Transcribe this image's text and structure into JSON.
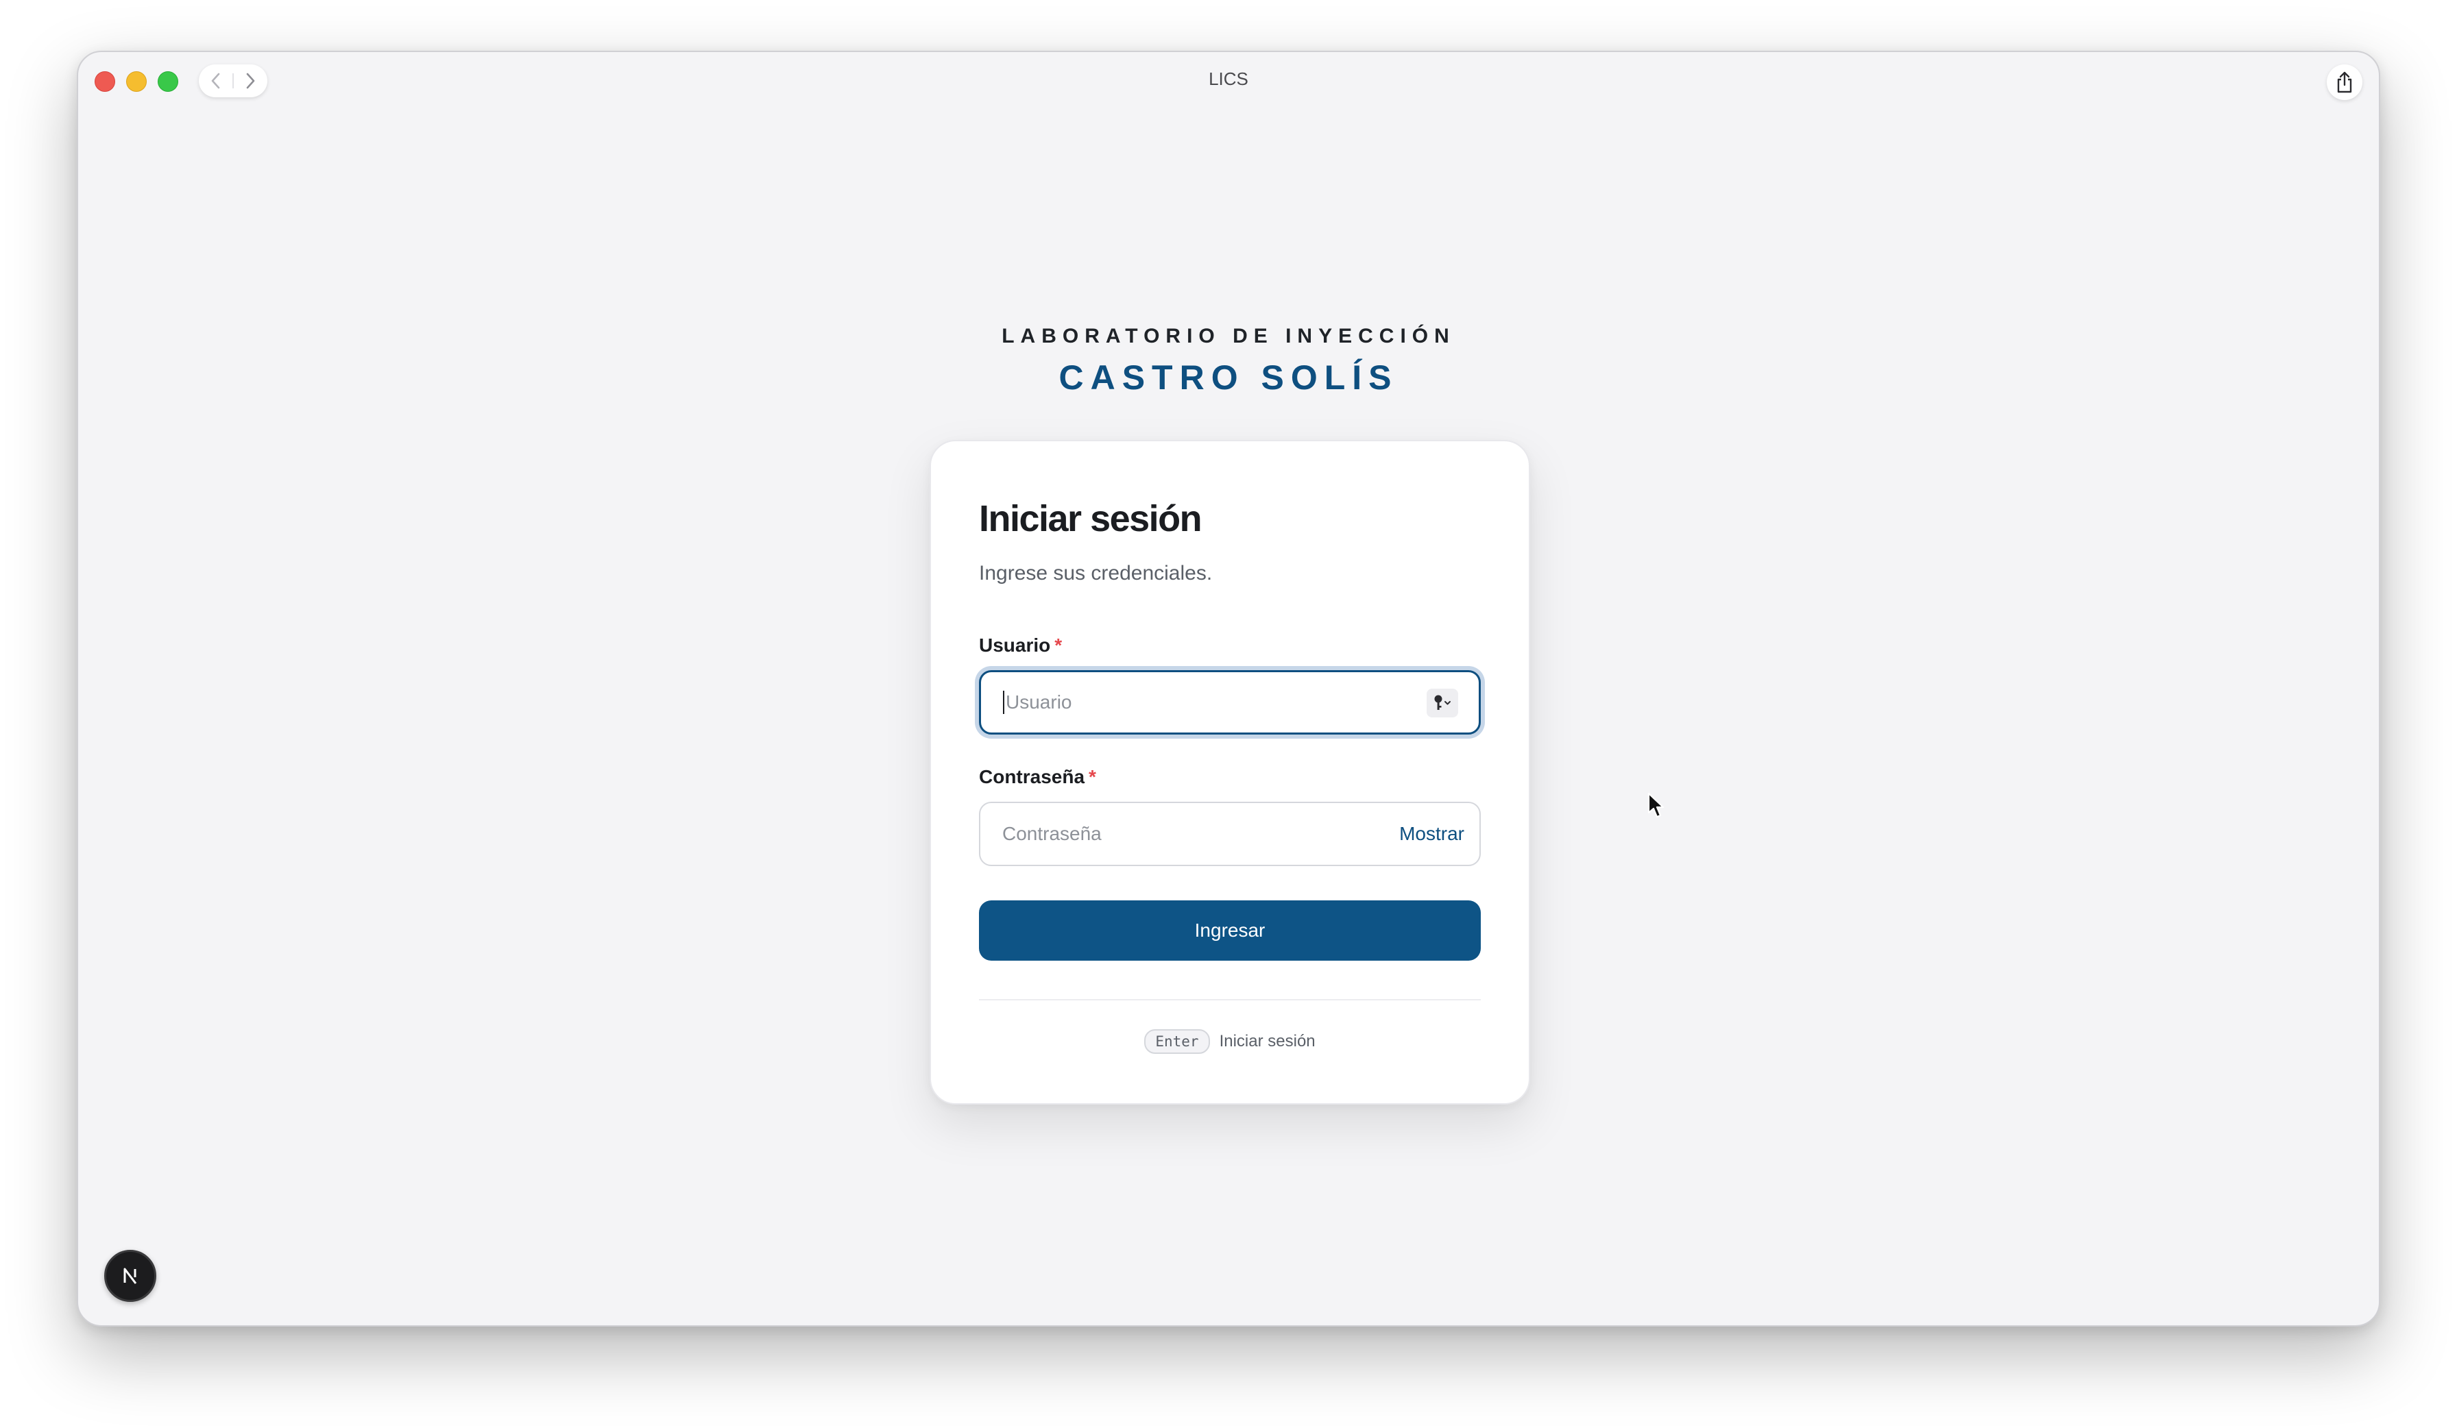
{
  "window": {
    "title": "LICS"
  },
  "brand": {
    "top_line": "LABORATORIO DE INYECCIÓN",
    "name": "CASTRO SOLÍS"
  },
  "login": {
    "title": "Iniciar sesión",
    "subtitle": "Ingrese sus credenciales.",
    "username": {
      "label": "Usuario",
      "required_mark": "*",
      "placeholder": "Usuario",
      "value": "",
      "autofill_icon": "key-icon"
    },
    "password": {
      "label": "Contraseña",
      "required_mark": "*",
      "placeholder": "Contraseña",
      "value": "",
      "toggle_label": "Mostrar"
    },
    "submit_label": "Ingresar",
    "shortcut": {
      "key": "Enter",
      "action": "Iniciar sesión"
    }
  },
  "colors": {
    "brand": "#0e4f80",
    "button": "#0e5486",
    "required": "#e5484d",
    "background": "#f4f4f6"
  },
  "icons": {
    "back": "chevron-left-icon",
    "forward": "chevron-right-icon",
    "share": "share-icon",
    "devtools": "nextjs-logo-icon"
  }
}
